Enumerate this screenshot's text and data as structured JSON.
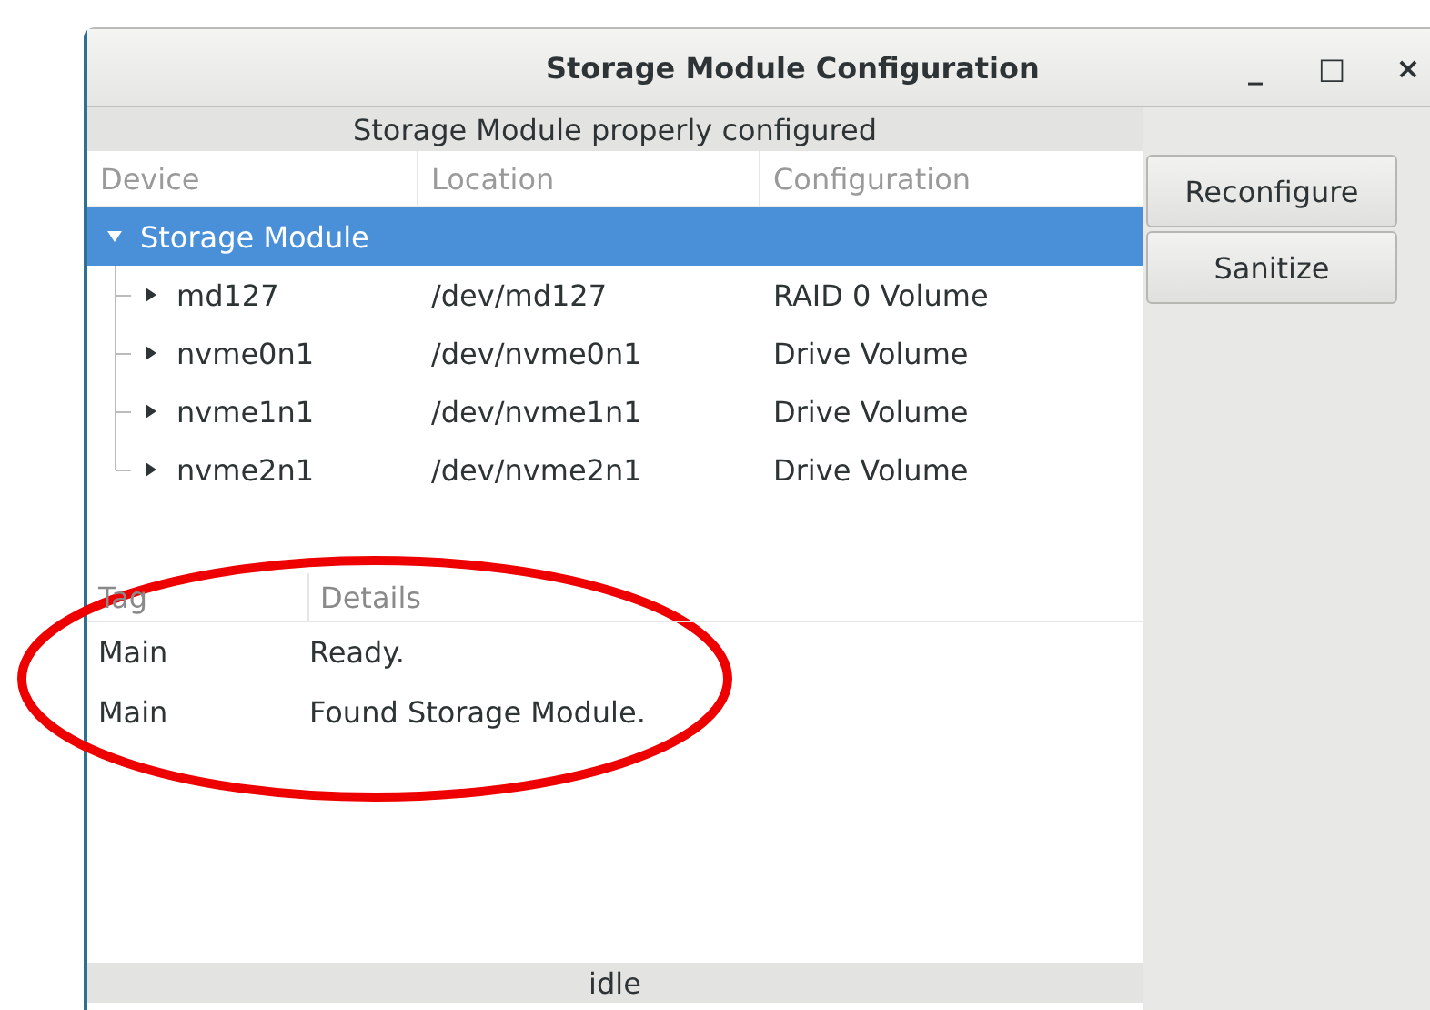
{
  "window": {
    "title": "Storage Module Configuration",
    "controls": [
      "_",
      "□",
      "×"
    ]
  },
  "status_message": "Storage Module properly configured",
  "device_table": {
    "columns": [
      "Device",
      "Location",
      "Configuration"
    ],
    "rows": [
      {
        "device": "Storage Module",
        "location": "",
        "configuration": "",
        "expanded": true,
        "selected": true,
        "children": [
          {
            "device": "md127",
            "location": "/dev/md127",
            "configuration": "RAID 0 Volume",
            "expanded": false,
            "selected": false
          },
          {
            "device": "nvme0n1",
            "location": "/dev/nvme0n1",
            "configuration": "Drive Volume",
            "expanded": false,
            "selected": false
          },
          {
            "device": "nvme1n1",
            "location": "/dev/nvme1n1",
            "configuration": "Drive Volume",
            "expanded": false,
            "selected": false
          },
          {
            "device": "nvme2n1",
            "location": "/dev/nvme2n1",
            "configuration": "Drive Volume",
            "expanded": false,
            "selected": false
          }
        ]
      }
    ]
  },
  "buttons": [
    "Reconfigure",
    "Sanitize"
  ],
  "log_table": {
    "columns": [
      "Tag",
      "Details"
    ],
    "rows": [
      {
        "tag": "Main",
        "details": "Ready."
      },
      {
        "tag": "Main",
        "details": "Found Storage Module."
      }
    ]
  },
  "status_bar": "idle"
}
